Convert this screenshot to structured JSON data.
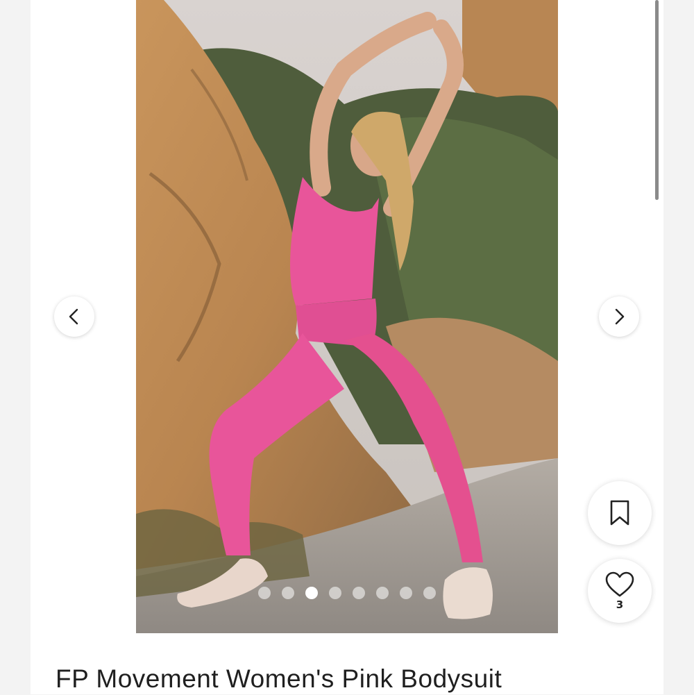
{
  "carousel": {
    "prev_icon": "chevron-left-icon",
    "next_icon": "chevron-right-icon",
    "image_count": 8,
    "active_index": 2
  },
  "actions": {
    "save_icon": "bookmark-icon",
    "like_icon": "heart-icon",
    "like_count": "3"
  },
  "listing": {
    "title": "FP Movement Women's Pink Bodysuit"
  },
  "colors": {
    "bodysuit_pink": "#e8559a",
    "page_background": "#ffffff"
  }
}
